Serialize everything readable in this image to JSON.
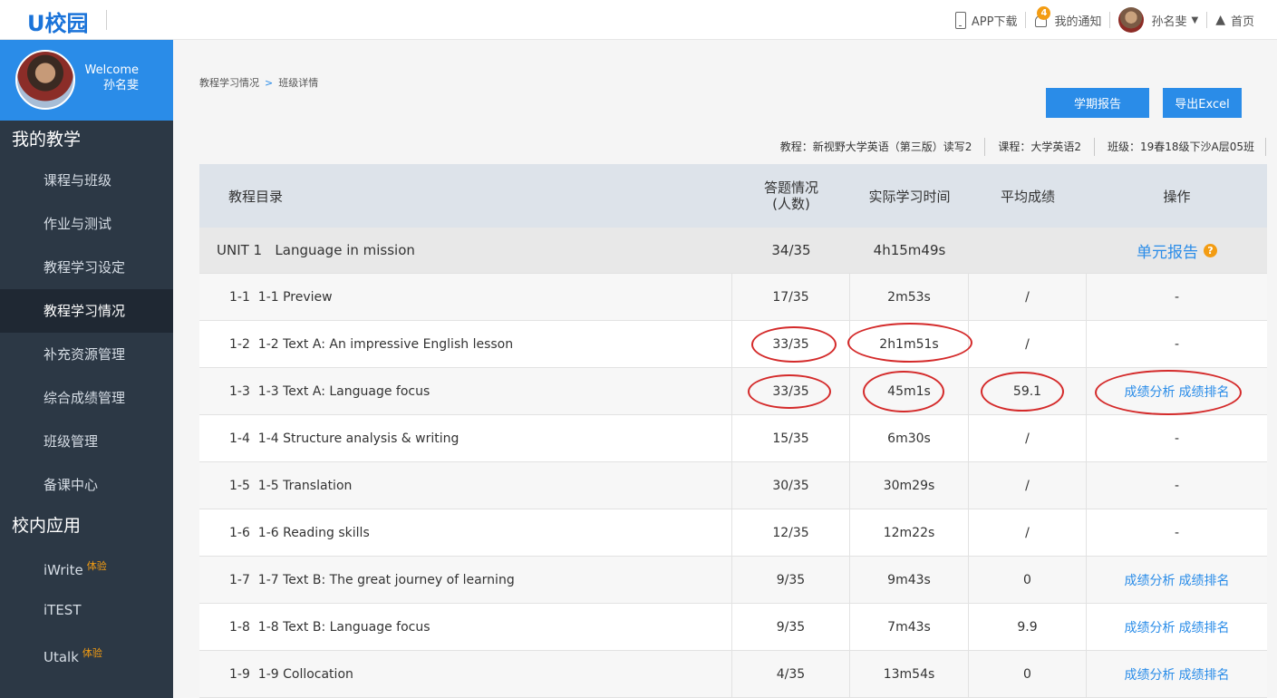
{
  "brand": {
    "logo_text": "U校园"
  },
  "topnav": {
    "app_download": "APP下载",
    "notifications": "我的通知",
    "notification_count": "4",
    "user_name": "孙名斐",
    "user_caret": "▼",
    "home": "首页"
  },
  "sidebar": {
    "welcome": "Welcome",
    "user_name": "孙名斐",
    "section1": "我的教学",
    "items": [
      {
        "label": "课程与班级"
      },
      {
        "label": "作业与测试"
      },
      {
        "label": "教程学习设定"
      },
      {
        "label": "教程学习情况"
      },
      {
        "label": "补充资源管理"
      },
      {
        "label": "综合成绩管理"
      },
      {
        "label": "班级管理"
      },
      {
        "label": "备课中心"
      }
    ],
    "section2": "校内应用",
    "apps": [
      {
        "label": "iWrite",
        "tag": "体验"
      },
      {
        "label": "iTEST",
        "tag": ""
      },
      {
        "label": "Utalk",
        "tag": "体验"
      }
    ]
  },
  "breadcrumb": {
    "parent": "教程学习情况",
    "separator": ">",
    "current": "班级详情"
  },
  "buttons": {
    "term_report": "学期报告",
    "export_excel": "导出Excel"
  },
  "info": {
    "textbook": "教程：新视野大学英语（第三版）读写2",
    "course": "课程：大学英语2",
    "class": "班级：19春18级下沙A层05班"
  },
  "table": {
    "headers": {
      "catalog": "教程目录",
      "answers": "答题情况\n(人数)",
      "time": "实际学习时间",
      "avg": "平均成绩",
      "action": "操作"
    },
    "unit": {
      "title": "UNIT 1   Language in mission",
      "answers": "34/35",
      "time": "4h15m49s",
      "report": "单元报告",
      "help": "?"
    },
    "rows": [
      {
        "id": "1-1",
        "title": "1-1 Preview",
        "answers": "17/35",
        "time": "2m53s",
        "avg": "/",
        "op": "-"
      },
      {
        "id": "1-2",
        "title": "1-2 Text A: An impressive English lesson",
        "answers": "33/35",
        "time": "2h1m51s",
        "avg": "/",
        "op": "-"
      },
      {
        "id": "1-3",
        "title": "1-3 Text A: Language focus",
        "answers": "33/35",
        "time": "45m1s",
        "avg": "59.1",
        "op_analysis": "成绩分析",
        "op_rank": "成绩排名"
      },
      {
        "id": "1-4",
        "title": "1-4 Structure analysis & writing",
        "answers": "15/35",
        "time": "6m30s",
        "avg": "/",
        "op": "-"
      },
      {
        "id": "1-5",
        "title": "1-5 Translation",
        "answers": "30/35",
        "time": "30m29s",
        "avg": "/",
        "op": "-"
      },
      {
        "id": "1-6",
        "title": "1-6 Reading skills",
        "answers": "12/35",
        "time": "12m22s",
        "avg": "/",
        "op": "-"
      },
      {
        "id": "1-7",
        "title": "1-7 Text B: The great journey of learning",
        "answers": "9/35",
        "time": "9m43s",
        "avg": "0",
        "op_analysis": "成绩分析",
        "op_rank": "成绩排名"
      },
      {
        "id": "1-8",
        "title": "1-8 Text B: Language focus",
        "answers": "9/35",
        "time": "7m43s",
        "avg": "9.9",
        "op_analysis": "成绩分析",
        "op_rank": "成绩排名"
      },
      {
        "id": "1-9",
        "title": "1-9 Collocation",
        "answers": "4/35",
        "time": "13m54s",
        "avg": "0",
        "op_analysis": "成绩分析",
        "op_rank": "成绩排名"
      }
    ]
  },
  "colors": {
    "accent": "#2a8ce8",
    "sidebar": "#2c3845",
    "annotation": "#d42a2a",
    "tag": "#f39c12"
  }
}
